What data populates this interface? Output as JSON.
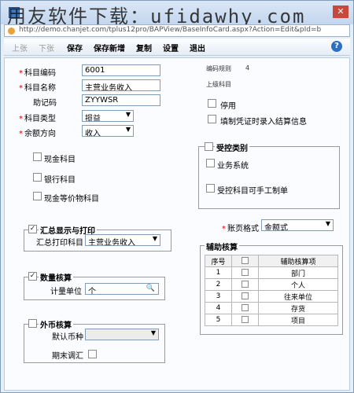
{
  "watermark": "用友软件下载：ufidawhy.com",
  "address": "http://demo.chanjet.com/tplus12pro/BAPView/BaseInfoCard.aspx?Action=Edit&pId=b",
  "toolbar": {
    "buttons": [
      {
        "label": "上张",
        "enabled": false
      },
      {
        "label": "下张",
        "enabled": false
      },
      {
        "label": "保存",
        "enabled": true
      },
      {
        "label": "保存新增",
        "enabled": true
      },
      {
        "label": "复制",
        "enabled": true
      },
      {
        "label": "设置",
        "enabled": true
      },
      {
        "label": "退出",
        "enabled": true
      }
    ],
    "help": "?"
  },
  "form": {
    "code_label": "科目编码",
    "code_value": "6001",
    "name_label": "科目名称",
    "name_value": "主营业务收入",
    "mnemonic_label": "助记码",
    "mnemonic_value": "ZYYWSR",
    "type_label": "科目类型",
    "type_value": "损益",
    "direction_label": "余额方向",
    "direction_value": "收入",
    "encode_rule_label": "编码规则",
    "encode_rule_value": "4",
    "parent_label": "上级科目",
    "disabled_label": "停用",
    "settle_label": "填制凭证时录入结算信息",
    "cash_label": "现金科目",
    "bank_label": "银行科目",
    "cash_eq_label": "现金等价物科目"
  },
  "controlled": {
    "title": "受控类别",
    "business_label": "业务系统",
    "manual_label": "受控科目可手工制单"
  },
  "summary": {
    "title": "汇总显示与打印",
    "print_label": "汇总打印科目",
    "print_value": "主营业务收入"
  },
  "quantity": {
    "title": "数量核算",
    "unit_label": "计量单位",
    "unit_value": "个"
  },
  "foreign": {
    "title": "外币核算",
    "currency_label": "默认币种",
    "adjust_label": "期末调汇"
  },
  "ledger": {
    "label": "账页格式",
    "value": "金额式"
  },
  "aux": {
    "title": "辅助核算",
    "headers": [
      "序号",
      "",
      "辅助核算项"
    ],
    "rows": [
      {
        "no": "1",
        "item": "部门"
      },
      {
        "no": "2",
        "item": "个人"
      },
      {
        "no": "3",
        "item": "往来单位"
      },
      {
        "no": "4",
        "item": "存货"
      },
      {
        "no": "5",
        "item": "项目"
      }
    ]
  }
}
